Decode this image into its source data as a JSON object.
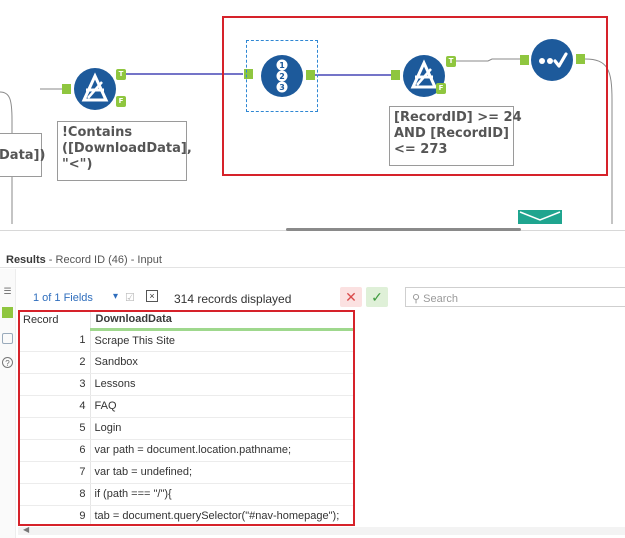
{
  "workflow": {
    "annotations": {
      "left": "Data])",
      "contains": "!Contains\n([DownloadData],\n\"<\")",
      "recordid": "[RecordID] >= 24\nAND [RecordID]\n<= 273"
    },
    "anchor_labels": {
      "true": "T",
      "false": "F"
    },
    "record_id_digits": [
      "1",
      "2",
      "3"
    ],
    "colors": {
      "tool_blue": "#1d5a9b",
      "anchor_green": "#8fc63f",
      "wire_blue": "#2020a8",
      "selection_red": "#d6222a"
    }
  },
  "results": {
    "title_bold": "Results",
    "title_rest": " - Record ID (46) - Input",
    "fields_label": "1 of 1 Fields",
    "record_count": "314 records displayed",
    "search_placeholder": "Search",
    "columns": [
      "Record",
      "DownloadData"
    ],
    "rows": [
      {
        "record": "1",
        "value": "Scrape This Site"
      },
      {
        "record": "2",
        "value": "Sandbox"
      },
      {
        "record": "3",
        "value": "Lessons"
      },
      {
        "record": "4",
        "value": "FAQ"
      },
      {
        "record": "5",
        "value": "Login"
      },
      {
        "record": "6",
        "value": "var path = document.location.pathname;"
      },
      {
        "record": "7",
        "value": "var tab = undefined;"
      },
      {
        "record": "8",
        "value": "if (path === \"/\"){"
      },
      {
        "record": "9",
        "value": "tab = document.querySelector(\"#nav-homepage\");"
      }
    ]
  }
}
